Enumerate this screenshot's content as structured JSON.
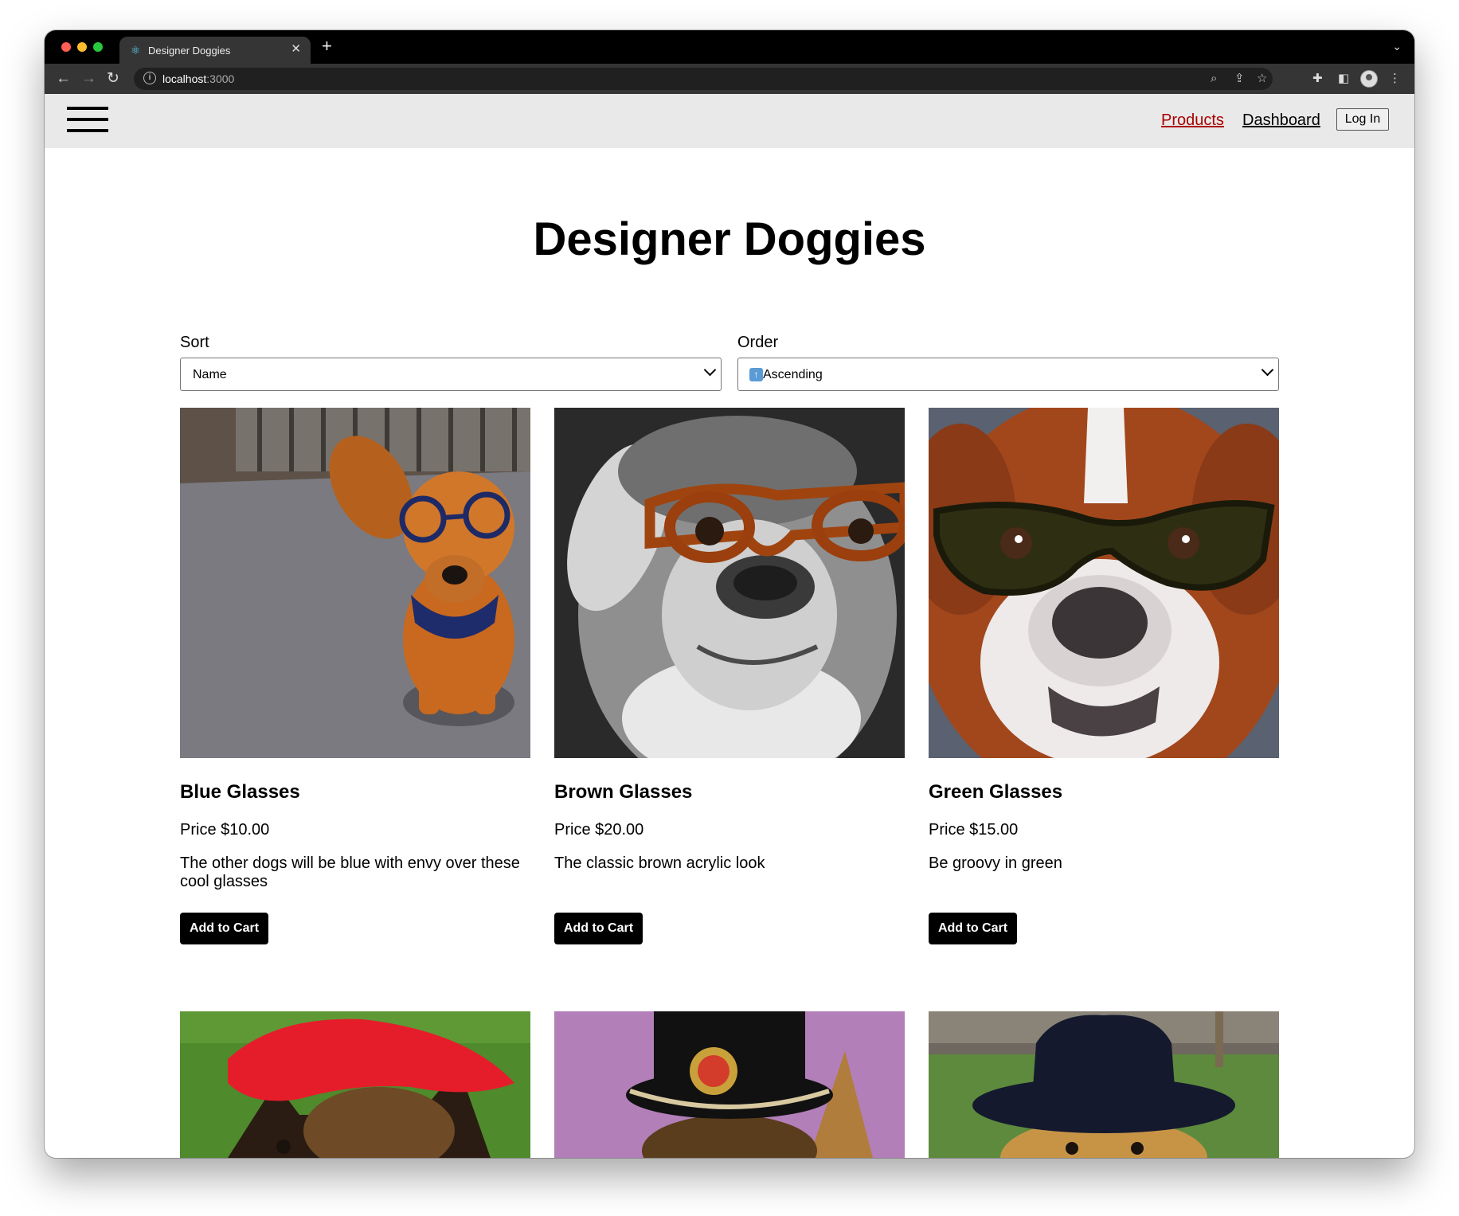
{
  "browser": {
    "tab_title": "Designer Doggies",
    "url_host": "localhost",
    "url_port": ":3000"
  },
  "nav": {
    "products": "Products",
    "dashboard": "Dashboard",
    "login": "Log In",
    "active_color": "#aa0000"
  },
  "page": {
    "title": "Designer Doggies"
  },
  "controls": {
    "sort_label": "Sort",
    "sort_value": "Name",
    "order_label": "Order",
    "order_value": "Ascending"
  },
  "products": [
    {
      "name": "Blue Glasses",
      "price": "Price $10.00",
      "description": "The other dogs will be blue with envy over these cool glasses",
      "button": "Add to Cart"
    },
    {
      "name": "Brown Glasses",
      "price": "Price $20.00",
      "description": "The classic brown acrylic look",
      "button": "Add to Cart"
    },
    {
      "name": "Green Glasses",
      "price": "Price $15.00",
      "description": "Be groovy in green",
      "button": "Add to Cart"
    }
  ],
  "icons": [
    "react-icon",
    "close-icon",
    "plus-icon",
    "chevron-down-icon",
    "back-icon",
    "forward-icon",
    "reload-icon",
    "info-icon",
    "zoom-icon",
    "share-icon",
    "star-icon",
    "extensions-icon",
    "sidebar-icon",
    "profile-icon",
    "more-icon",
    "hamburger-icon",
    "up-arrow-icon"
  ]
}
